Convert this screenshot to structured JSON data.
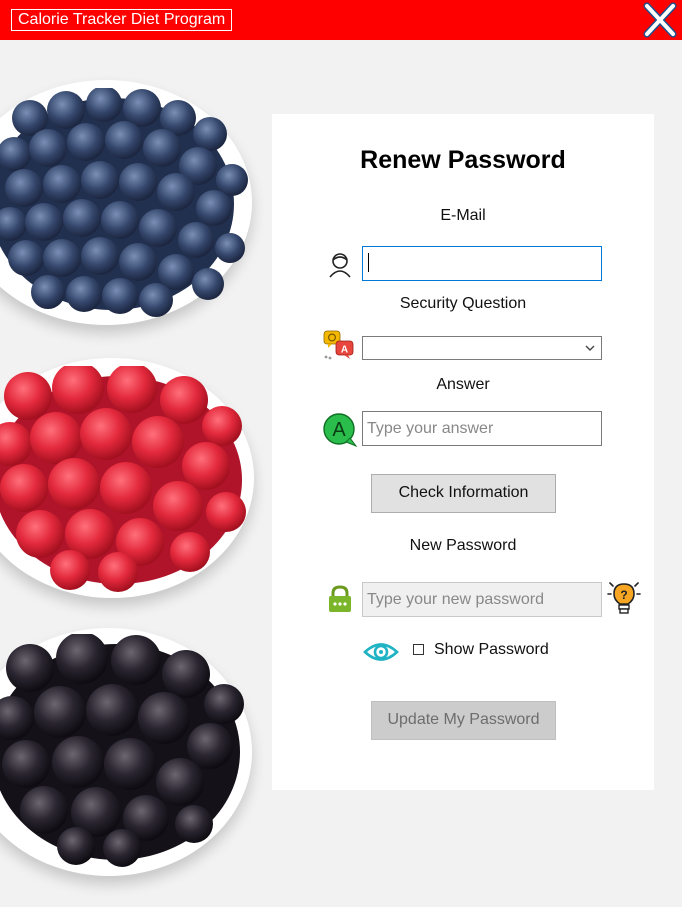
{
  "window": {
    "title": "Calorie Tracker Diet Program",
    "close_icon": "close-icon"
  },
  "form": {
    "heading": "Renew Password",
    "email": {
      "label": "E-Mail",
      "value": "",
      "icon": "user-icon"
    },
    "security_question": {
      "label": "Security Question",
      "selected": "",
      "icon": "translate-chat-icon"
    },
    "answer": {
      "label": "Answer",
      "placeholder": "Type your answer",
      "icon": "answer-a-icon"
    },
    "check_button": "Check Information",
    "new_password": {
      "label": "New Password",
      "placeholder": "Type your new password",
      "icon": "lock-icon",
      "hint_icon": "lightbulb-icon"
    },
    "show_password": {
      "label": "Show Password",
      "checked": false,
      "icon": "eye-icon"
    },
    "update_button": "Update My Password"
  },
  "colors": {
    "titlebar": "#ff0000",
    "focus_border": "#0078d7"
  },
  "background": {
    "image": "bowls of blueberries, raspberries and blackberries"
  }
}
